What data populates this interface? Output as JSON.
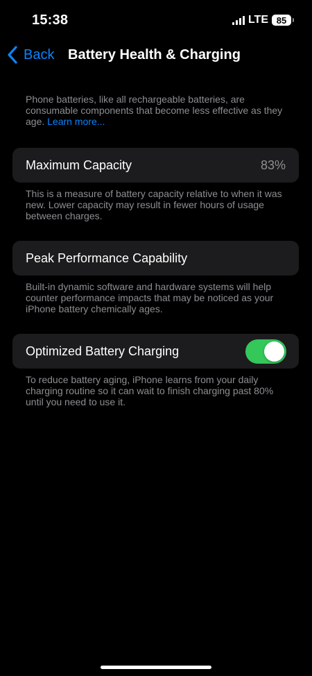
{
  "status_bar": {
    "time": "15:38",
    "network": "LTE",
    "battery_level": "85",
    "signal_icon": "cellular-signal-icon",
    "battery_icon": "battery-icon"
  },
  "nav": {
    "back_label": "Back",
    "back_icon": "chevron-left-icon",
    "title": "Battery Health & Charging"
  },
  "intro": {
    "text": "Phone batteries, like all rechargeable batteries, are consumable components that become less effective as they age.",
    "link_label": "Learn more..."
  },
  "maximum_capacity": {
    "label": "Maximum Capacity",
    "value": "83%",
    "footer": "This is a measure of battery capacity relative to when it was new. Lower capacity may result in fewer hours of usage between charges."
  },
  "peak_performance": {
    "label": "Peak Performance Capability",
    "footer": "Built-in dynamic software and hardware systems will help counter performance impacts that may be noticed as your iPhone battery chemically ages."
  },
  "optimized_charging": {
    "label": "Optimized Battery Charging",
    "enabled": true,
    "footer": "To reduce battery aging, iPhone learns from your daily charging routine so it can wait to finish charging past 80% until you need to use it."
  },
  "colors": {
    "accent": "#0a84ff",
    "toggle_on": "#34c759",
    "cell_background": "#1c1c1e",
    "secondary_text": "#8e8e93"
  }
}
